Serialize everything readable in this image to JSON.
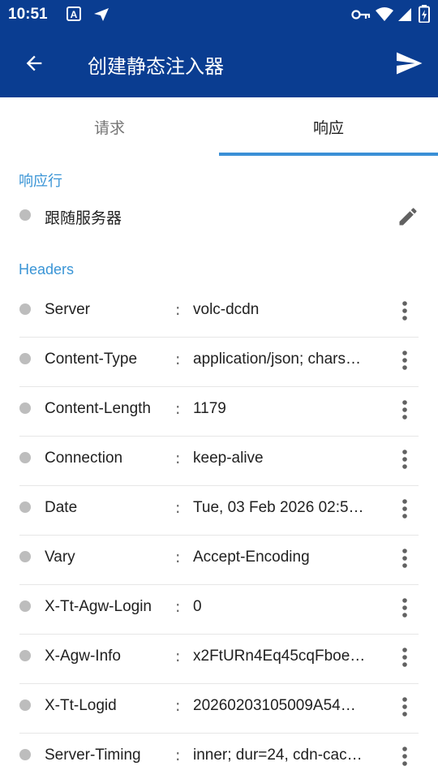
{
  "status_bar": {
    "time": "10:51",
    "icons": [
      "a-badge-icon",
      "plane-icon",
      "key-icon",
      "wifi-icon",
      "signal-icon",
      "battery-icon"
    ]
  },
  "app_bar": {
    "title": "创建静态注入器",
    "back_icon": "arrow-left-icon",
    "send_icon": "send-icon",
    "color": "#0a3d91"
  },
  "tabs": [
    {
      "label": "请求",
      "selected": false
    },
    {
      "label": "响应",
      "selected": true
    }
  ],
  "accent_color": "#3a95d6",
  "response_line": {
    "section_title": "响应行",
    "value": "跟随服务器",
    "edit_icon": "pencil-icon"
  },
  "headers": {
    "section_title": "Headers",
    "separator": ":",
    "items": [
      {
        "name": "Server",
        "value": "volc-dcdn"
      },
      {
        "name": "Content-Type",
        "value": "application/json; chars…"
      },
      {
        "name": "Content-Length",
        "value": "1179"
      },
      {
        "name": "Connection",
        "value": "keep-alive"
      },
      {
        "name": "Date",
        "value": "Tue, 03 Feb 2026 02:5…"
      },
      {
        "name": "Vary",
        "value": "Accept-Encoding"
      },
      {
        "name": "X-Tt-Agw-Login",
        "value": "0"
      },
      {
        "name": "X-Agw-Info",
        "value": "x2FtURn4Eq45cqFboe…"
      },
      {
        "name": "X-Tt-Logid",
        "value": "20260203105009A54…"
      },
      {
        "name": "Server-Timing",
        "value": "inner; dur=24, cdn-cac…"
      }
    ]
  }
}
